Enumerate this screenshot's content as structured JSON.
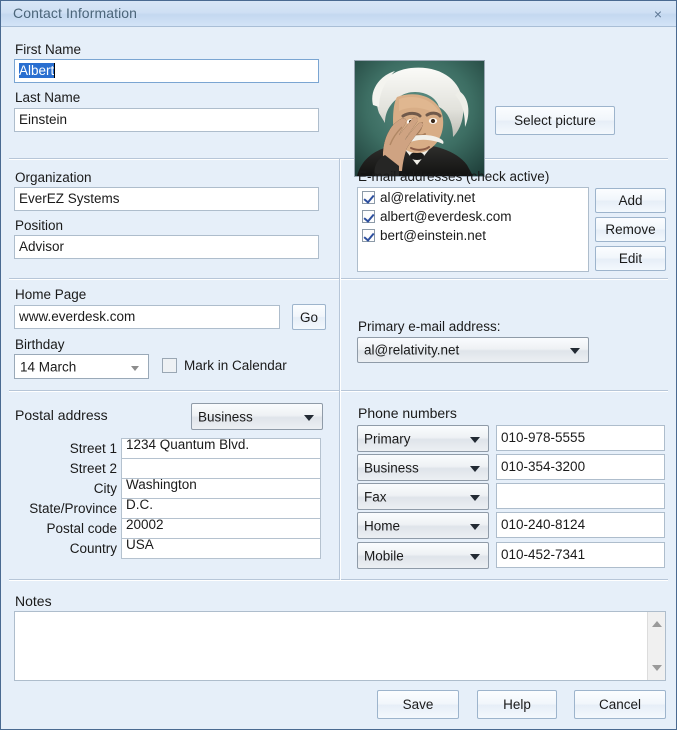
{
  "window": {
    "title": "Contact Information",
    "close_label": "×"
  },
  "name_section": {
    "first_name_label": "First Name",
    "first_name_value": "Albert",
    "last_name_label": "Last Name",
    "last_name_value": "Einstein",
    "select_picture_label": "Select picture",
    "picture_alt": "portrait-photo"
  },
  "org_section": {
    "organization_label": "Organization",
    "organization_value": "EverEZ Systems",
    "position_label": "Position",
    "position_value": "Advisor"
  },
  "web_section": {
    "home_page_label": "Home Page",
    "home_page_value": "www.everdesk.com",
    "go_label": "Go",
    "birthday_label": "Birthday",
    "birthday_value": "14 March",
    "mark_in_calendar_label": "Mark in Calendar",
    "mark_in_calendar_checked": false
  },
  "email_section": {
    "title": "E-mail addresses (check active)",
    "items": [
      {
        "address": "al@relativity.net",
        "checked": true
      },
      {
        "address": "albert@everdesk.com",
        "checked": true
      },
      {
        "address": "bert@einstein.net",
        "checked": true
      }
    ],
    "add_label": "Add",
    "remove_label": "Remove",
    "edit_label": "Edit",
    "primary_label": "Primary e-mail address:",
    "primary_value": "al@relativity.net"
  },
  "postal_section": {
    "title": "Postal address",
    "type_value": "Business",
    "fields": [
      {
        "label": "Street 1",
        "value": "1234 Quantum Blvd."
      },
      {
        "label": "Street 2",
        "value": ""
      },
      {
        "label": "City",
        "value": "Washington"
      },
      {
        "label": "State/Province",
        "value": "D.C."
      },
      {
        "label": "Postal code",
        "value": "20002"
      },
      {
        "label": "Country",
        "value": "USA"
      }
    ]
  },
  "phone_section": {
    "title": "Phone numbers",
    "rows": [
      {
        "type": "Primary",
        "number": "010-978-5555"
      },
      {
        "type": "Business",
        "number": "010-354-3200"
      },
      {
        "type": "Fax",
        "number": ""
      },
      {
        "type": "Home",
        "number": "010-240-8124"
      },
      {
        "type": "Mobile",
        "number": "010-452-7341"
      }
    ]
  },
  "notes_section": {
    "label": "Notes",
    "value": ""
  },
  "footer": {
    "save_label": "Save",
    "help_label": "Help",
    "cancel_label": "Cancel"
  },
  "colors": {
    "window_background": "#e6eff9",
    "titlebar_background": "#cfe0f4",
    "selection_blue": "#2a6fd0",
    "border": "#aebdcc",
    "text": "#1a1a1a"
  }
}
